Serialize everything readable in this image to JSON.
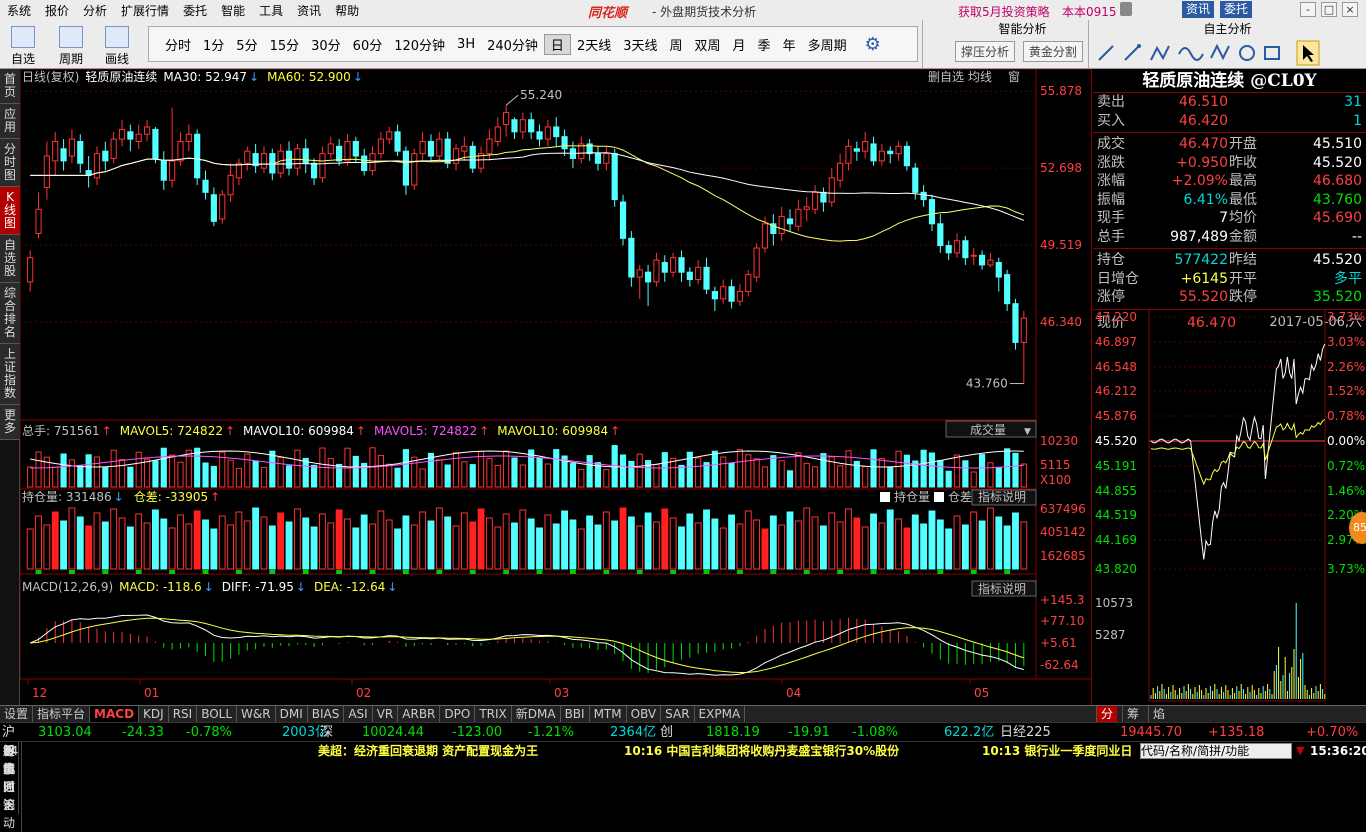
{
  "menu": {
    "items": [
      "系统",
      "报价",
      "分析",
      "扩展行情",
      "委托",
      "智能",
      "工具",
      "资讯",
      "帮助"
    ],
    "logo": "同花顺",
    "title": "- 外盘期货技术分析",
    "promo1": "获取5月投资策略",
    "promo2": "本本0915",
    "btn_info": "资讯",
    "btn_trade": "委托",
    "win": [
      "-",
      "□",
      "×"
    ]
  },
  "toolbar": {
    "tools": [
      {
        "label": "自选股",
        "icon": "star-icon"
      },
      {
        "label": "周期",
        "icon": "cycle-icon"
      },
      {
        "label": "画线",
        "icon": "pen-icon"
      }
    ],
    "periods": [
      "分时",
      "1分",
      "5分",
      "15分",
      "30分",
      "60分",
      "120分钟",
      "3H",
      "240分钟",
      "日",
      "2天线",
      "3天线",
      "周",
      "双周",
      "月",
      "季",
      "年",
      "多周期"
    ],
    "active_period": "日",
    "smart_title": "智能分析",
    "smart_buttons": [
      "撑压分析",
      "黄金分割"
    ],
    "self_title": "自主分析"
  },
  "left_tabs": [
    "首页",
    "应用",
    "分时图",
    "K线图",
    "自选股",
    "综合排名",
    "上证指数",
    "更多"
  ],
  "active_left_tab": "K线图",
  "chart_header": {
    "line1": "日线(复权)",
    "name": "轻质原油连续",
    "ma30": "MA30: 52.947",
    "ma60": "MA60: 52.900",
    "tools": [
      "删自选",
      "均线",
      "窗"
    ]
  },
  "chart_data": {
    "type": "candlestick",
    "ylim": [
      42.5,
      56.3
    ],
    "price_ticks": [
      "55.878",
      "52.698",
      "49.519",
      "46.340"
    ],
    "high_label": "55.240",
    "low_label": "43.760",
    "x_labels": [
      "12",
      "01",
      "02",
      "03",
      "04",
      "05"
    ],
    "candles": [
      [
        48.0,
        49.0,
        47.6,
        49.3
      ],
      [
        50.0,
        51.0,
        49.8,
        51.7
      ],
      [
        51.9,
        53.2,
        51.4,
        53.8
      ],
      [
        53.0,
        53.8,
        52.4,
        54.2
      ],
      [
        53.5,
        53.0,
        52.6,
        53.9
      ],
      [
        53.2,
        53.9,
        52.9,
        54.3
      ],
      [
        53.8,
        52.9,
        52.5,
        54.1
      ],
      [
        52.6,
        52.4,
        51.9,
        53.2
      ],
      [
        52.3,
        53.3,
        52.0,
        53.6
      ],
      [
        53.4,
        53.0,
        52.6,
        53.8
      ],
      [
        53.1,
        53.9,
        52.9,
        54.2
      ],
      [
        53.9,
        54.3,
        53.6,
        54.7
      ],
      [
        54.2,
        53.9,
        53.4,
        54.5
      ],
      [
        53.8,
        54.1,
        53.5,
        54.5
      ],
      [
        54.1,
        54.4,
        53.8,
        54.7
      ],
      [
        54.3,
        53.1,
        52.9,
        54.4
      ],
      [
        53.0,
        52.2,
        51.8,
        53.4
      ],
      [
        52.2,
        53.0,
        51.9,
        55.2
      ],
      [
        53.0,
        53.8,
        52.8,
        54.2
      ],
      [
        53.8,
        54.1,
        53.4,
        54.5
      ],
      [
        54.1,
        52.3,
        52.0,
        54.3
      ],
      [
        52.2,
        51.7,
        51.4,
        52.6
      ],
      [
        51.6,
        50.5,
        50.3,
        51.9
      ],
      [
        50.6,
        51.6,
        50.4,
        51.8
      ],
      [
        51.6,
        52.4,
        51.3,
        52.9
      ],
      [
        52.3,
        52.9,
        52.0,
        53.1
      ],
      [
        52.9,
        53.4,
        52.6,
        53.6
      ],
      [
        53.3,
        52.8,
        52.5,
        53.7
      ],
      [
        52.7,
        53.3,
        52.5,
        53.6
      ],
      [
        53.3,
        52.5,
        52.2,
        53.5
      ],
      [
        52.5,
        53.4,
        52.3,
        53.7
      ],
      [
        53.4,
        52.7,
        52.4,
        53.8
      ],
      [
        52.7,
        53.5,
        52.4,
        53.7
      ],
      [
        53.5,
        52.9,
        52.5,
        53.9
      ],
      [
        52.9,
        52.3,
        52.0,
        53.1
      ],
      [
        52.3,
        53.3,
        52.1,
        53.6
      ],
      [
        53.3,
        53.7,
        53.1,
        54.0
      ],
      [
        53.6,
        53.0,
        52.8,
        53.9
      ],
      [
        53.0,
        53.8,
        52.8,
        54.1
      ],
      [
        53.8,
        53.2,
        52.9,
        54.0
      ],
      [
        53.2,
        52.6,
        52.4,
        53.5
      ],
      [
        52.6,
        53.3,
        52.4,
        53.6
      ],
      [
        53.3,
        53.9,
        53.1,
        54.2
      ],
      [
        53.9,
        54.2,
        53.7,
        54.4
      ],
      [
        54.2,
        53.4,
        53.2,
        54.5
      ],
      [
        53.4,
        52.0,
        51.6,
        53.6
      ],
      [
        52.0,
        53.3,
        51.8,
        53.5
      ],
      [
        53.3,
        53.8,
        53.0,
        54.2
      ],
      [
        53.8,
        53.2,
        53.0,
        54.1
      ],
      [
        53.2,
        53.9,
        53.0,
        54.2
      ],
      [
        53.9,
        52.9,
        52.7,
        54.2
      ],
      [
        52.9,
        53.5,
        52.6,
        53.7
      ],
      [
        53.4,
        53.6,
        53.0,
        54.0
      ],
      [
        53.6,
        52.7,
        52.5,
        53.8
      ],
      [
        52.7,
        53.3,
        52.5,
        53.6
      ],
      [
        53.3,
        53.9,
        53.0,
        54.3
      ],
      [
        53.8,
        54.4,
        53.6,
        54.8
      ],
      [
        54.5,
        55.0,
        54.0,
        55.3
      ],
      [
        54.7,
        54.2,
        53.9,
        54.8
      ],
      [
        54.2,
        54.7,
        53.9,
        55.0
      ],
      [
        54.7,
        54.2,
        53.9,
        55.0
      ],
      [
        54.2,
        53.9,
        53.6,
        54.5
      ],
      [
        53.9,
        54.4,
        53.6,
        54.7
      ],
      [
        54.4,
        54.0,
        53.6,
        54.8
      ],
      [
        54.0,
        53.5,
        53.2,
        54.3
      ],
      [
        53.5,
        53.1,
        52.7,
        53.8
      ],
      [
        53.1,
        53.7,
        52.9,
        54.0
      ],
      [
        53.7,
        53.3,
        53.0,
        53.9
      ],
      [
        53.3,
        52.9,
        52.6,
        53.6
      ],
      [
        52.9,
        53.3,
        52.6,
        53.6
      ],
      [
        53.3,
        51.4,
        51.1,
        53.5
      ],
      [
        51.3,
        49.8,
        49.5,
        51.6
      ],
      [
        49.8,
        48.2,
        47.8,
        50.1
      ],
      [
        48.2,
        48.5,
        47.3,
        48.7
      ],
      [
        48.4,
        48.0,
        47.0,
        48.7
      ],
      [
        48.0,
        48.9,
        47.8,
        49.2
      ],
      [
        48.8,
        48.4,
        48.0,
        49.1
      ],
      [
        48.4,
        49.0,
        48.2,
        49.2
      ],
      [
        49.0,
        48.4,
        48.0,
        49.3
      ],
      [
        48.4,
        48.1,
        47.8,
        48.6
      ],
      [
        48.1,
        48.6,
        47.9,
        48.9
      ],
      [
        48.6,
        47.7,
        47.5,
        49.0
      ],
      [
        47.6,
        47.3,
        46.8,
        47.8
      ],
      [
        47.3,
        47.8,
        47.1,
        48.1
      ],
      [
        47.8,
        47.2,
        46.9,
        48.1
      ],
      [
        47.2,
        47.6,
        47.0,
        47.9
      ],
      [
        47.6,
        48.3,
        47.4,
        48.5
      ],
      [
        48.2,
        49.4,
        48.0,
        49.6
      ],
      [
        49.4,
        50.4,
        49.2,
        50.7
      ],
      [
        50.4,
        50.0,
        49.5,
        50.8
      ],
      [
        50.0,
        50.7,
        49.7,
        51.1
      ],
      [
        50.6,
        50.4,
        50.1,
        51.0
      ],
      [
        50.3,
        51.0,
        50.1,
        51.4
      ],
      [
        51.0,
        51.1,
        50.5,
        51.5
      ],
      [
        51.0,
        51.7,
        50.8,
        52.0
      ],
      [
        51.7,
        51.3,
        50.9,
        51.9
      ],
      [
        51.3,
        52.3,
        51.1,
        52.7
      ],
      [
        52.2,
        52.9,
        51.9,
        53.3
      ],
      [
        52.9,
        53.6,
        52.6,
        53.9
      ],
      [
        53.5,
        53.4,
        53.0,
        53.8
      ],
      [
        53.4,
        53.8,
        53.1,
        54.2
      ],
      [
        53.7,
        53.0,
        52.8,
        54.0
      ],
      [
        53.0,
        53.4,
        52.8,
        53.7
      ],
      [
        53.4,
        53.3,
        52.9,
        53.6
      ],
      [
        53.3,
        53.6,
        53.0,
        53.8
      ],
      [
        53.6,
        52.8,
        52.6,
        53.8
      ],
      [
        52.7,
        51.7,
        51.4,
        52.9
      ],
      [
        51.7,
        51.4,
        51.1,
        52.0
      ],
      [
        51.4,
        50.4,
        50.1,
        51.6
      ],
      [
        50.4,
        49.5,
        49.2,
        50.8
      ],
      [
        49.5,
        49.2,
        48.9,
        49.7
      ],
      [
        49.2,
        49.7,
        49.0,
        50.0
      ],
      [
        49.7,
        49.0,
        48.7,
        49.9
      ],
      [
        49.1,
        49.1,
        48.7,
        49.4
      ],
      [
        49.1,
        48.7,
        48.5,
        49.3
      ],
      [
        48.7,
        48.9,
        48.6,
        49.2
      ],
      [
        48.8,
        48.2,
        47.6,
        49.0
      ],
      [
        48.3,
        47.1,
        46.8,
        48.5
      ],
      [
        47.1,
        45.5,
        45.2,
        47.3
      ],
      [
        45.5,
        46.5,
        43.8,
        46.8
      ]
    ],
    "ma30_color": "#ffff66",
    "ma60_color": "#ffffff",
    "volume": {
      "label": "总手: 751561",
      "mavol5": "MAVOL5: 724822",
      "mavol10": "MAVOL10: 609984",
      "mavol5b": "MAVOL5: 724822",
      "mavol10b": "MAVOL10: 609984",
      "ticks": [
        "10230",
        "5115",
        "X100"
      ],
      "dropdown": "成交量"
    },
    "oi": {
      "label": "持仓量: 331486",
      "diff": "仓差: -33905",
      "ticks": [
        "637496",
        "405142",
        "162685"
      ],
      "check1": "持仓量",
      "check2": "仓差",
      "explain": "指标说明"
    },
    "macd": {
      "label": "MACD(12,26,9)",
      "macd": "MACD: -118.6",
      "diff": "DIFF: -71.95",
      "dea": "DEA: -12.64",
      "ticks": [
        "+145.3",
        "+77.10",
        "+5.61",
        "-62.64"
      ],
      "explain": "指标说明"
    }
  },
  "quote": {
    "title": "轻质原油连续 @CL0Y",
    "rows1": [
      {
        "k": "卖出",
        "v": "46.510",
        "c": "red",
        "v2": "31",
        "c2": "cyn"
      },
      {
        "k": "买入",
        "v": "46.420",
        "c": "red",
        "v2": "1",
        "c2": "cyn"
      }
    ],
    "rows2": [
      {
        "k": "成交",
        "v": "46.470",
        "c": "red",
        "k2": "开盘",
        "v2": "45.510",
        "c2": "wht"
      },
      {
        "k": "涨跌",
        "v": "+0.950",
        "c": "red",
        "k2": "昨收",
        "v2": "45.520",
        "c2": "wht"
      },
      {
        "k": "涨幅",
        "v": "+2.09%",
        "c": "red",
        "k2": "最高",
        "v2": "46.680",
        "c2": "red"
      },
      {
        "k": "振幅",
        "v": "6.41%",
        "c": "cyn",
        "k2": "最低",
        "v2": "43.760",
        "c2": "grn"
      },
      {
        "k": "现手",
        "v": "7",
        "c": "wht",
        "k2": "均价",
        "v2": "45.690",
        "c2": "red"
      },
      {
        "k": "总手",
        "v": "987,489",
        "c": "wht",
        "k2": "金额",
        "v2": "--",
        "c2": "wht"
      }
    ],
    "rows3": [
      {
        "k": "持仓",
        "v": "577422",
        "c": "cyn",
        "k2": "昨结",
        "v2": "45.520",
        "c2": "wht"
      },
      {
        "k": "日增仓",
        "v": "+6145",
        "c": "yel",
        "k2": "开平",
        "v2": "多平",
        "c2": "cyn"
      },
      {
        "k": "涨停",
        "v": "55.520",
        "c": "red",
        "k2": "跌停",
        "v2": "35.520",
        "c2": "grn"
      }
    ],
    "now_label": "现价",
    "now_price": "46.470",
    "date": "2017-05-06,六",
    "mini_left": [
      "47.220",
      "46.897",
      "46.548",
      "46.212",
      "45.876",
      "45.520",
      "45.191",
      "44.855",
      "44.519",
      "44.169",
      "43.820",
      "10573",
      "5287"
    ],
    "mini_right": [
      "3.73%",
      "3.03%",
      "2.26%",
      "1.52%",
      "0.78%",
      "0.00%",
      "0.72%",
      "1.46%",
      "2.20%",
      "2.97%",
      "3.73%"
    ],
    "bubble": "85"
  },
  "bottom_tabs": [
    "设置",
    "指标平台",
    "MACD",
    "KDJ",
    "RSI",
    "BOLL",
    "W&R",
    "DMI",
    "BIAS",
    "ASI",
    "VR",
    "ARBR",
    "DPO",
    "TRIX",
    "新DMA",
    "BBI",
    "MTM",
    "OBV",
    "SAR",
    "EXPMA"
  ],
  "active_bottom_tab": "MACD",
  "bottom_right_tabs": [
    "分",
    "筹",
    "焰"
  ],
  "status": {
    "sh_label": "沪",
    "sh_index": "3103.04",
    "sh_chg": "-24.33",
    "sh_pct": "-0.78%",
    "sh_amt": "2003亿",
    "sz_label": "深",
    "sz_index": "10024.44",
    "sz_chg": "-123.00",
    "sz_pct": "-1.21%",
    "sz_amt": "2364亿",
    "cy_label": "创",
    "cy_index": "1818.19",
    "cy_chg": "-19.91",
    "cy_pct": "-1.08%",
    "cy_amt": "622.2亿",
    "nk_label": "日经225",
    "nk_index": "19445.70",
    "nk_chg": "+135.18",
    "nk_pct": "+0.70%"
  },
  "news": {
    "buttons": [
      "手机",
      "智能问答",
      "解盘",
      "股市日记",
      "股灵通",
      "行情",
      "24小时滚动"
    ],
    "n1": "美超：经济重回衰退期 资产配置现金为王",
    "n2": "10:16 中国吉利集团将收购丹麦盛宝银行30%股份",
    "n3": "10:13 银行业一季度同业日",
    "code_ph": "代码/名称/简拼/功能",
    "clock": "15:36:20"
  }
}
